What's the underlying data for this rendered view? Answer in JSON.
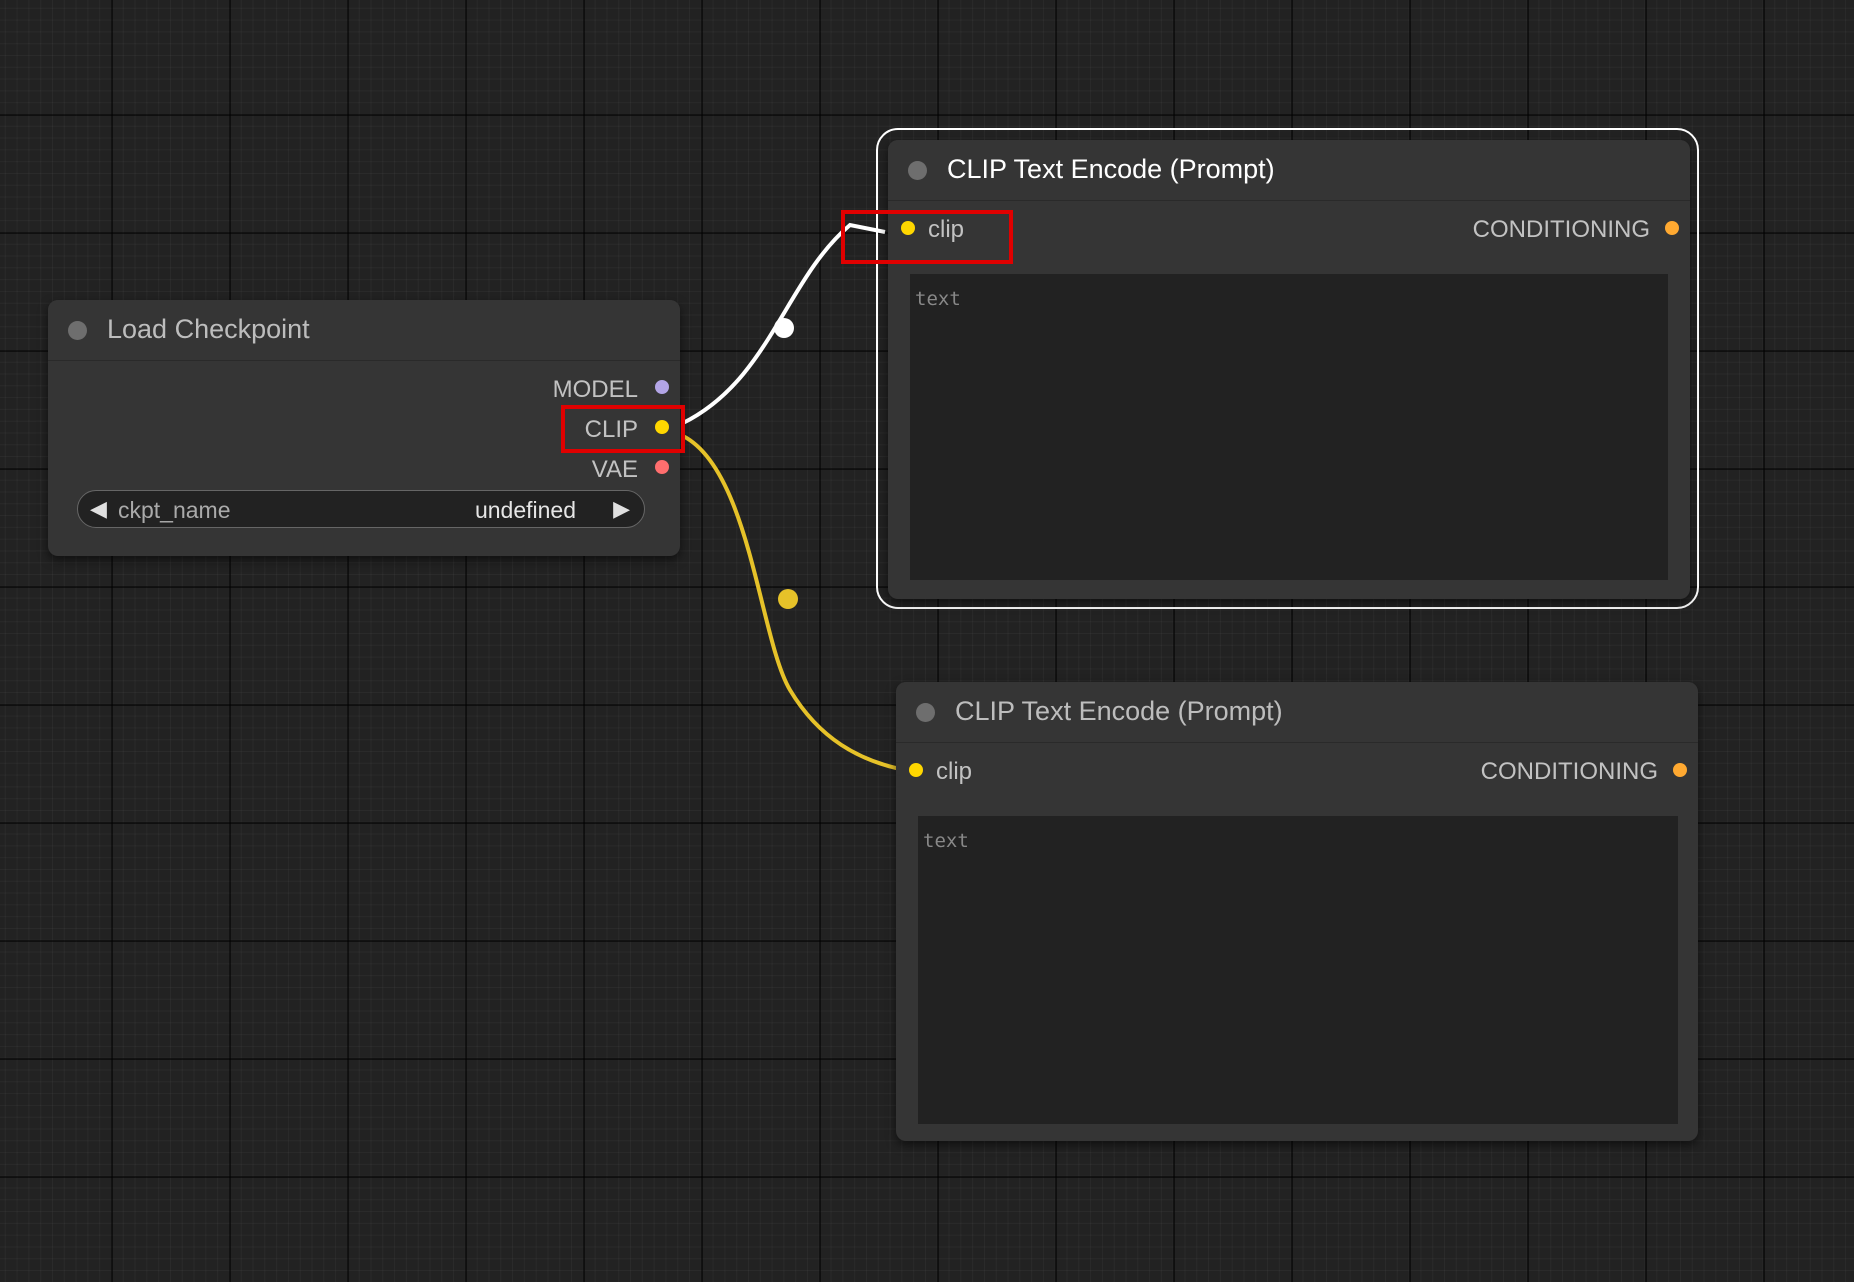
{
  "nodes": {
    "load_checkpoint": {
      "title": "Load Checkpoint",
      "outputs": [
        {
          "label": "MODEL",
          "color": "#b3a5e6"
        },
        {
          "label": "CLIP",
          "color": "#ffd700"
        },
        {
          "label": "VAE",
          "color": "#ff6e6e"
        }
      ],
      "widget": {
        "name": "ckpt_name",
        "value": "undefined",
        "left_arrow": "◀",
        "right_arrow": "▶"
      }
    },
    "clip_encode_top": {
      "title": "CLIP Text Encode (Prompt)",
      "selected": true,
      "input": {
        "label": "clip",
        "color": "#ffd700"
      },
      "output": {
        "label": "CONDITIONING",
        "color": "#ffa931"
      },
      "text_placeholder": "text"
    },
    "clip_encode_bottom": {
      "title": "CLIP Text Encode (Prompt)",
      "selected": false,
      "input": {
        "label": "clip",
        "color": "#ffd700"
      },
      "output": {
        "label": "CONDITIONING",
        "color": "#ffa931"
      },
      "text_placeholder": "text"
    }
  },
  "links": [
    {
      "from": "CLIP",
      "to": "clip_encode_top.clip",
      "color": "#ffffff"
    },
    {
      "from": "CLIP",
      "to": "clip_encode_bottom.clip",
      "color": "#e6c229"
    }
  ],
  "highlight_color": "#e00000"
}
